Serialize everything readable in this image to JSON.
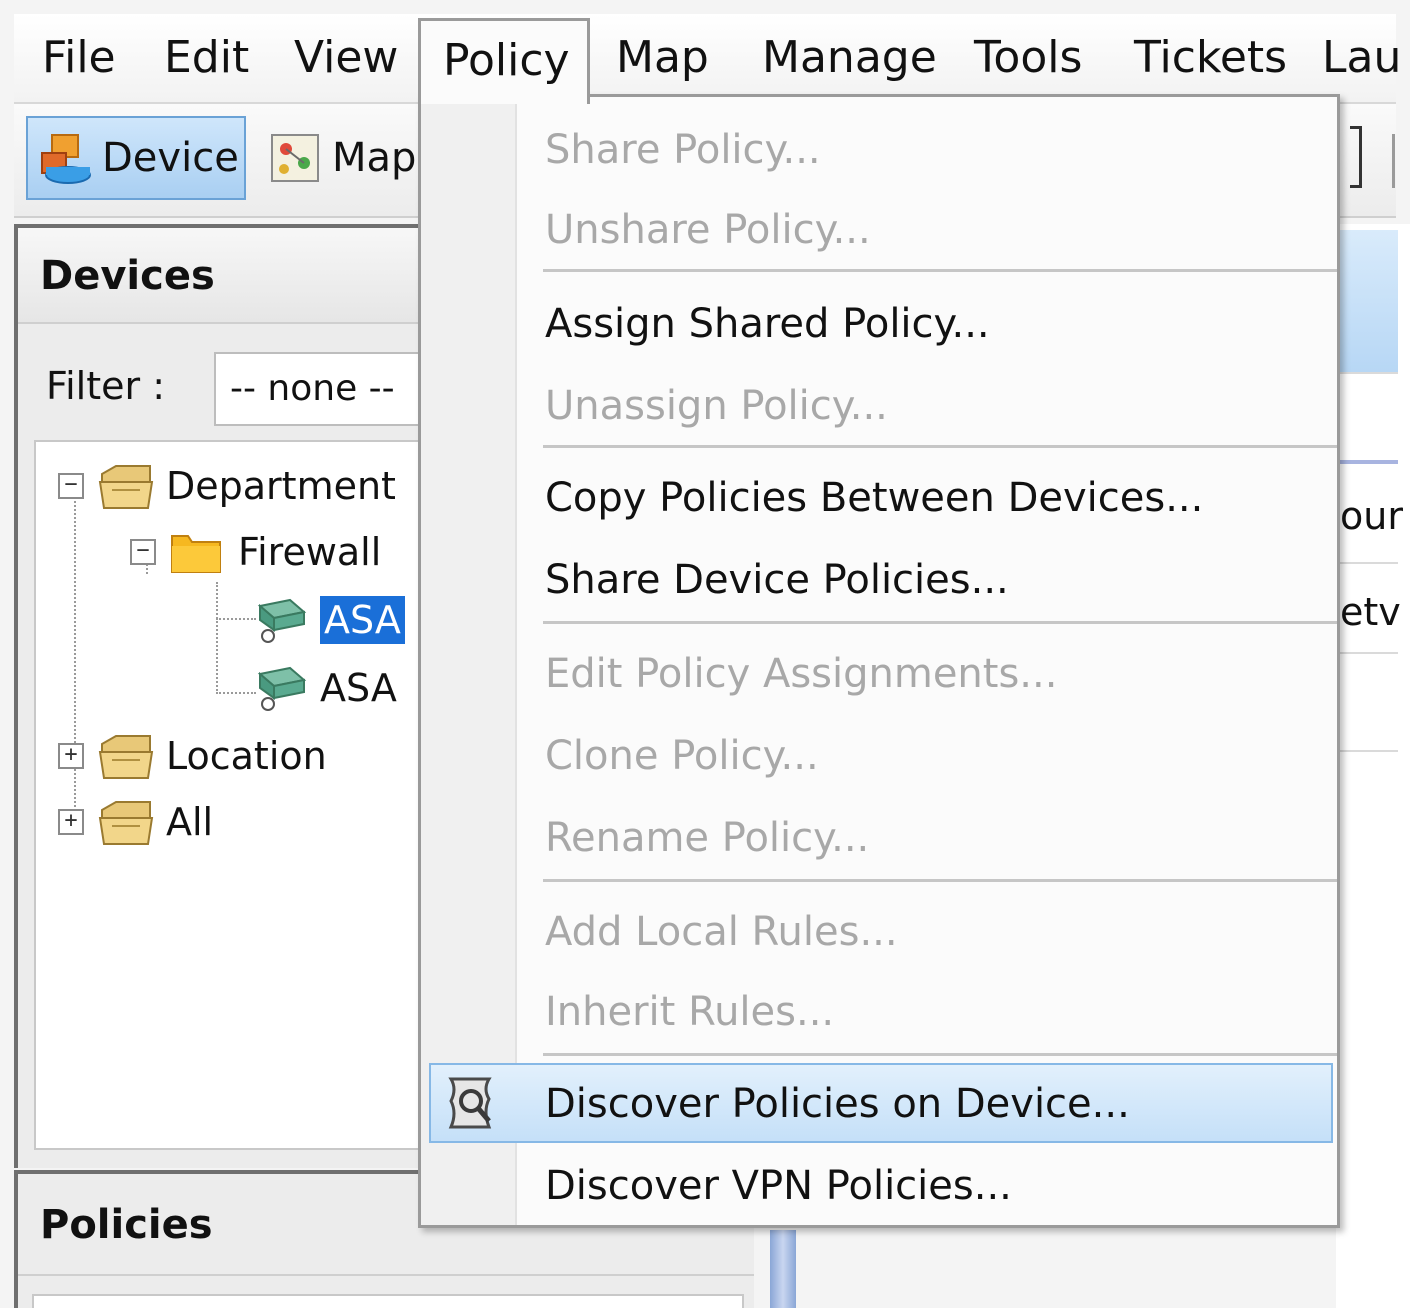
{
  "menubar": {
    "items": [
      {
        "label": "File"
      },
      {
        "label": "Edit"
      },
      {
        "label": "View"
      },
      {
        "label": "Policy"
      },
      {
        "label": "Map"
      },
      {
        "label": "Manage"
      },
      {
        "label": "Tools"
      },
      {
        "label": "Tickets"
      },
      {
        "label": "Lau"
      }
    ]
  },
  "toolbar": {
    "device_label": "Device",
    "map_label": "Map"
  },
  "devices_panel": {
    "title": "Devices",
    "filter_label": "Filter :",
    "filter_value": "-- none --",
    "tree": {
      "department": "Department",
      "firewall": "Firewall",
      "asa_1": "ASA",
      "asa_2": "ASA",
      "location": "Location",
      "all": "All"
    }
  },
  "policies_panel": {
    "title": "Policies"
  },
  "right_partial": {
    "text_1": "our",
    "text_2": "etv"
  },
  "policy_menu": {
    "share_policy": "Share Policy...",
    "unshare_policy": "Unshare Policy...",
    "assign_shared_policy": "Assign Shared Policy...",
    "unassign_policy": "Unassign Policy...",
    "copy_policies_between_devices": "Copy Policies Between Devices...",
    "share_device_policies": "Share Device Policies...",
    "edit_policy_assignments": "Edit Policy Assignments...",
    "clone_policy": "Clone Policy...",
    "rename_policy": "Rename Policy...",
    "add_local_rules": "Add Local Rules...",
    "inherit_rules": "Inherit Rules...",
    "discover_policies_on_device": "Discover Policies on Device...",
    "discover_vpn_policies": "Discover VPN Policies..."
  }
}
